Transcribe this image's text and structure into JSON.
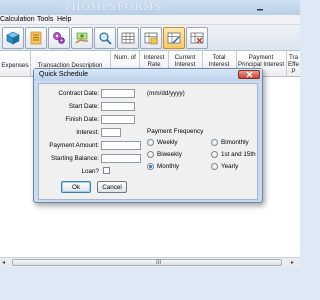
{
  "window": {
    "watermark": "THOMPSFORMS"
  },
  "menubar": {
    "items": [
      "Calculation",
      "Tools",
      "Help"
    ]
  },
  "toolbar": {
    "buttons": [
      "cube-icon",
      "checklist-icon",
      "gears-icon",
      "hand-money-icon",
      "search-icon",
      "table-grid-icon",
      "table-grid-add-icon",
      "table-grid-edit-icon",
      "table-grid-remove-icon"
    ]
  },
  "grid": {
    "headers": [
      "Expenses",
      "Transaction Description",
      "Num. of",
      "Interest Rate",
      "Current Interest",
      "Total Interest",
      "Payment Principal Interest",
      "Tra Effe P"
    ]
  },
  "dialog": {
    "title": "Quick Schedule",
    "close_glyph": "✕",
    "labels": {
      "contract_date": "Contract Date:",
      "start_date": "Start Date:",
      "finish_date": "Finish Date:",
      "interest": "Interest:",
      "payment_amount": "Payment Amount:",
      "starting_balance": "Starting Balance:",
      "loan": "Loan?"
    },
    "values": {
      "contract_date": "",
      "start_date": "",
      "finish_date": "",
      "interest": "",
      "payment_amount": "",
      "starting_balance": ""
    },
    "date_format_hint": "(mm/dd/yyyy)",
    "loan_checked": false,
    "payment_frequency": {
      "label": "Payment Frequency",
      "options": [
        "Weekly",
        "Biweekly",
        "Monthly",
        "Bimonthly",
        "1st and 15th",
        "Yearly"
      ],
      "selected": "Monthly"
    },
    "ok_label": "Ok",
    "cancel_label": "Cancel"
  },
  "scrollbar": {
    "grip": "III",
    "left_arrow": "◂",
    "right_arrow": "▸"
  }
}
